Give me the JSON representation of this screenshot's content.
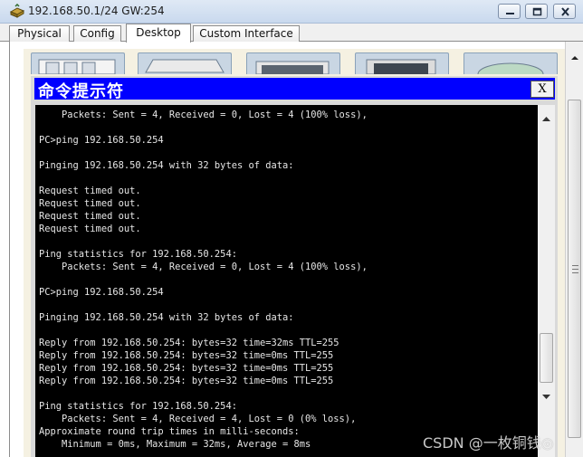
{
  "window": {
    "title": "192.168.50.1/24 GW:254",
    "icon": "router-device-icon",
    "controls": {
      "minimize": "minimize-icon",
      "maximize": "maximize-icon",
      "close": "close-icon"
    }
  },
  "tabs": [
    {
      "label": "Physical",
      "active": false
    },
    {
      "label": "Config",
      "active": false
    },
    {
      "label": "Desktop",
      "active": true
    },
    {
      "label": "Custom Interface",
      "active": false
    }
  ],
  "command_prompt": {
    "title": "命令提示符",
    "close_label": "X",
    "lines": [
      "    Packets: Sent = 4, Received = 0, Lost = 4 (100% loss),",
      "",
      "PC>ping 192.168.50.254",
      "",
      "Pinging 192.168.50.254 with 32 bytes of data:",
      "",
      "Request timed out.",
      "Request timed out.",
      "Request timed out.",
      "Request timed out.",
      "",
      "Ping statistics for 192.168.50.254:",
      "    Packets: Sent = 4, Received = 0, Lost = 4 (100% loss),",
      "",
      "PC>ping 192.168.50.254",
      "",
      "Pinging 192.168.50.254 with 32 bytes of data:",
      "",
      "Reply from 192.168.50.254: bytes=32 time=32ms TTL=255",
      "Reply from 192.168.50.254: bytes=32 time=0ms TTL=255",
      "Reply from 192.168.50.254: bytes=32 time=0ms TTL=255",
      "Reply from 192.168.50.254: bytes=32 time=0ms TTL=255",
      "",
      "Ping statistics for 192.168.50.254:",
      "    Packets: Sent = 4, Received = 4, Lost = 0 (0% loss),",
      "Approximate round trip times in milli-seconds:",
      "    Minimum = 0ms, Maximum = 32ms, Average = 8ms"
    ]
  },
  "watermark": "CSDN @一枚铜钱◎",
  "colors": {
    "cmd_title_bg": "#0000ff",
    "console_bg": "#000000",
    "console_text": "#e6e6e6"
  }
}
